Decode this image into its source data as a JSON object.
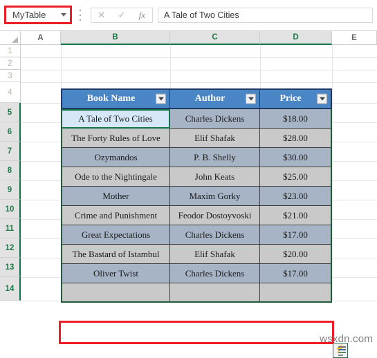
{
  "app": {
    "name": "Microsoft Excel",
    "watermark": "wsxdn.com"
  },
  "formula_bar": {
    "name_box": {
      "value": "MyTable",
      "highlighted": true,
      "highlight_color": "#ee1c25",
      "dropdown_icon": "chevron-down-icon"
    },
    "cancel_icon": "✕",
    "enter_icon": "✓",
    "function_icon": "fx",
    "formula_value": "A Tale of Two Cities"
  },
  "grid": {
    "column_headers": [
      {
        "label": "A",
        "selected": false
      },
      {
        "label": "B",
        "selected": true
      },
      {
        "label": "C",
        "selected": true
      },
      {
        "label": "D",
        "selected": true
      },
      {
        "label": "E",
        "selected": false
      }
    ],
    "row_headers": [
      {
        "label": "1",
        "selected": false
      },
      {
        "label": "2",
        "selected": false
      },
      {
        "label": "3",
        "selected": false
      },
      {
        "label": "4",
        "selected": false
      },
      {
        "label": "5",
        "selected": true
      },
      {
        "label": "6",
        "selected": true
      },
      {
        "label": "7",
        "selected": true
      },
      {
        "label": "8",
        "selected": true
      },
      {
        "label": "9",
        "selected": true
      },
      {
        "label": "10",
        "selected": true
      },
      {
        "label": "11",
        "selected": true
      },
      {
        "label": "12",
        "selected": true
      },
      {
        "label": "13",
        "selected": true
      },
      {
        "label": "14",
        "selected": true
      }
    ]
  },
  "table": {
    "name": "MyTable",
    "header_fill": "#4a86c5",
    "band_light": "#c9c9c9",
    "band_dark": "#a6b4c6",
    "active_cell_fill": "#d6e8f7",
    "filter_icon": "filter-dropdown-icon",
    "columns": [
      {
        "label": "Book Name",
        "has_filter": true
      },
      {
        "label": "Author",
        "has_filter": true
      },
      {
        "label": "Price",
        "has_filter": true
      }
    ],
    "rows": [
      {
        "book": "A Tale of Two Cities",
        "author": "Charles Dickens",
        "price": "$18.00",
        "band": "dark",
        "active": true
      },
      {
        "book": "The Forty Rules of Love",
        "author": "Elif Shafak",
        "price": "$28.00",
        "band": "light",
        "active": false
      },
      {
        "book": "Ozymandos",
        "author": "P. B. Shelly",
        "price": "$30.00",
        "band": "dark",
        "active": false
      },
      {
        "book": "Ode to the Nightingale",
        "author": "John Keats",
        "price": "$25.00",
        "band": "light",
        "active": false
      },
      {
        "book": "Mother",
        "author": "Maxim Gorky",
        "price": "$23.00",
        "band": "dark",
        "active": false
      },
      {
        "book": "Crime and Punishment",
        "author": "Feodor Dostoyvoski",
        "price": "$21.00",
        "band": "light",
        "active": false
      },
      {
        "book": "Great Expectations",
        "author": "Charles Dickens",
        "price": "$17.00",
        "band": "dark",
        "active": false
      },
      {
        "book": "The Bastard of Istambul",
        "author": "Elif Shafak",
        "price": "$20.00",
        "band": "light",
        "active": false
      },
      {
        "book": "Oliver Twist",
        "author": "Charles Dickens",
        "price": "$17.00",
        "band": "dark",
        "active": false
      },
      {
        "book": "",
        "author": "",
        "price": "",
        "band": "light",
        "active": false
      }
    ]
  },
  "callout": {
    "color": "#ee1c25",
    "target": "empty-new-table-row"
  },
  "quick_analysis": {
    "icon": "quick-analysis-icon"
  }
}
